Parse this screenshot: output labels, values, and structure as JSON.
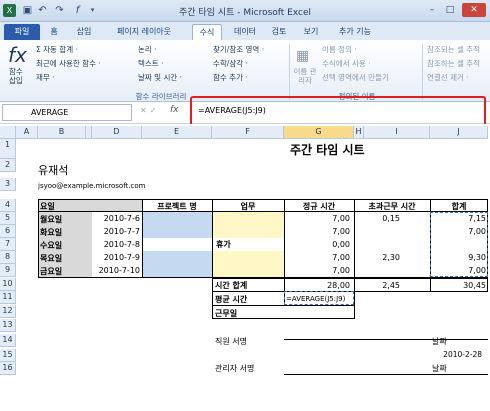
{
  "window": {
    "title": "주간 타임 시트 - Microsoft Excel"
  },
  "tabs": [
    "파일",
    "홈",
    "삽입",
    "페이지 레이아웃",
    "수식",
    "데이터",
    "검토",
    "보기",
    "추가 기능"
  ],
  "ribbon": {
    "fx_label": "함수\n삽입",
    "items": [
      "Σ 자동 합계 ·",
      "최근에 사용한 함수 ·",
      "재무 ·",
      "논리 ·",
      "텍스트 ·",
      "날짜 및 시간 ·",
      "찾기/참조 영역 ·",
      "수학/삼각 ·",
      "함수 추가 ·",
      "이름 정의 ·",
      "수식에서 사용 ·",
      "선택 영역에서 만들기",
      "참조되는 셀 추적",
      "참조하는 셀 추적",
      "연결선 제거 ·",
      "이름 관리자"
    ],
    "groups": [
      "함수 라이브러리",
      "정의된 이름"
    ]
  },
  "formula_bar": {
    "name_box": "AVERAGE",
    "fx": "fx",
    "formula": "=AVERAGE(J5:J9)"
  },
  "columns": [
    "A",
    "B",
    "C",
    "D",
    "E",
    "F",
    "G",
    "H",
    "I",
    "J"
  ],
  "rows": [
    "1",
    "2",
    "3",
    "4",
    "5",
    "6",
    "7",
    "8",
    "9",
    "10",
    "11",
    "12",
    "13",
    "14",
    "15",
    "16"
  ],
  "sheet": {
    "title": "주간 타임 시트",
    "name": "유재석",
    "email": "jsyoo@example.microsoft.com",
    "headers": {
      "day": "요일",
      "project": "프로젝트 명",
      "task": "업무",
      "regular": "정규 시간",
      "overtime": "초과근무 시간",
      "total": "합계"
    },
    "days": [
      {
        "day": "월요일",
        "date": "2010-7-6",
        "regular": "7,00",
        "overtime": "0,15",
        "total": "7,15"
      },
      {
        "day": "화요일",
        "date": "2010-7-7",
        "regular": "7,00",
        "overtime": "",
        "total": "7,00"
      },
      {
        "day": "수요일",
        "date": "2010-7-8",
        "holiday": "휴가",
        "regular": "0,00",
        "overtime": "",
        "total": ""
      },
      {
        "day": "목요일",
        "date": "2010-7-9",
        "regular": "7,00",
        "overtime": "2,30",
        "total": "9,30"
      },
      {
        "day": "금요일",
        "date": "2010-7-10",
        "regular": "7,00",
        "overtime": "",
        "total": "7,00"
      }
    ],
    "summary": {
      "total_label": "시간 합계",
      "total_regular": "28,00",
      "total_overtime": "2,45",
      "grand_total": "30,45",
      "avg_label": "평균 시간",
      "avg_formula": "=AVERAGE(J5:J9)",
      "workdays_label": "근무일"
    },
    "signatures": {
      "employee": "직원 서명",
      "date_label": "날짜",
      "date_value": "2010-2-28",
      "manager": "관리자 서명",
      "date_label2": "날짜"
    }
  }
}
